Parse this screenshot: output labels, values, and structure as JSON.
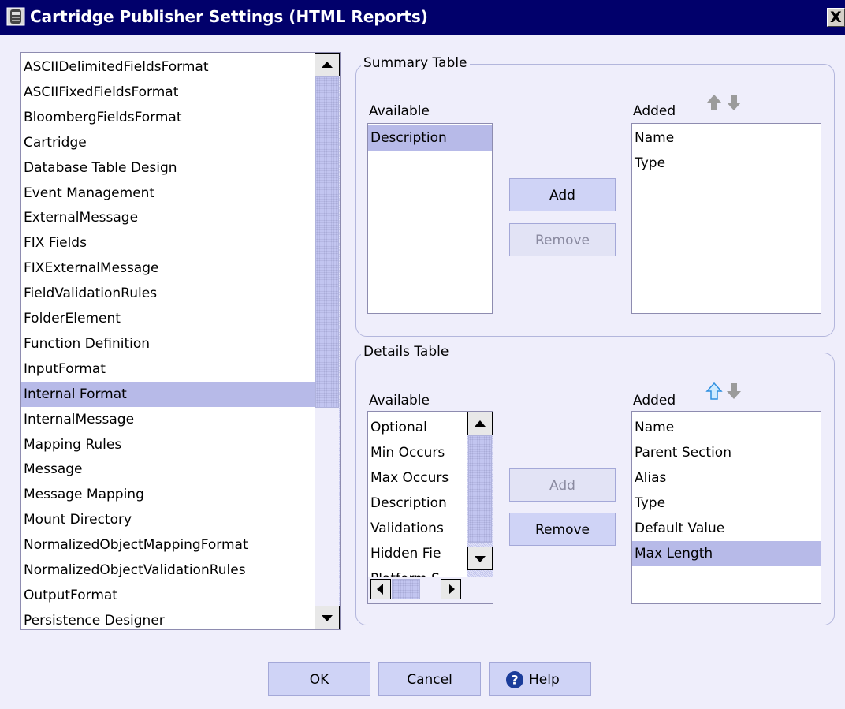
{
  "window": {
    "title": "Cartridge Publisher Settings (HTML Reports)",
    "close_label": "X"
  },
  "types_list": {
    "items": [
      "ASCIIDelimitedFieldsFormat",
      "ASCIIFixedFieldsFormat",
      "BloombergFieldsFormat",
      "Cartridge",
      "Database Table Design",
      "Event Management",
      "ExternalMessage",
      "FIX Fields",
      "FIXExternalMessage",
      "FieldValidationRules",
      "FolderElement",
      "Function Definition",
      "InputFormat",
      "Internal Format",
      "InternalMessage",
      "Mapping Rules",
      "Message",
      "Message Mapping",
      "Mount Directory",
      "NormalizedObjectMappingFormat",
      "NormalizedObjectValidationRules",
      "OutputFormat",
      "Persistence Designer"
    ],
    "selected": "Internal Format"
  },
  "summary_table": {
    "group_label": "Summary Table",
    "available_label": "Available",
    "added_label": "Added",
    "available_items": [
      "Description"
    ],
    "available_selected": "Description",
    "added_items": [
      "Name",
      "Type"
    ],
    "add_label": "Add",
    "remove_label": "Remove",
    "add_enabled": true,
    "remove_enabled": false
  },
  "details_table": {
    "group_label": "Details Table",
    "available_label": "Available",
    "added_label": "Added",
    "available_items": [
      "Optional",
      "Min Occurs",
      "Max Occurs",
      "Description",
      "Validations",
      "Hidden Fie",
      "Platform S"
    ],
    "added_items": [
      "Name",
      "Parent Section",
      "Alias",
      "Type",
      "Default Value",
      "Max Length"
    ],
    "added_selected": "Max Length",
    "add_label": "Add",
    "remove_label": "Remove",
    "add_enabled": false,
    "remove_enabled": true
  },
  "footer": {
    "ok_label": "OK",
    "cancel_label": "Cancel",
    "help_label": "Help"
  },
  "colors": {
    "title_bar": "#01006b",
    "background": "#efeefb",
    "selection": "#b7bae8",
    "button": "#cfd3f6"
  }
}
